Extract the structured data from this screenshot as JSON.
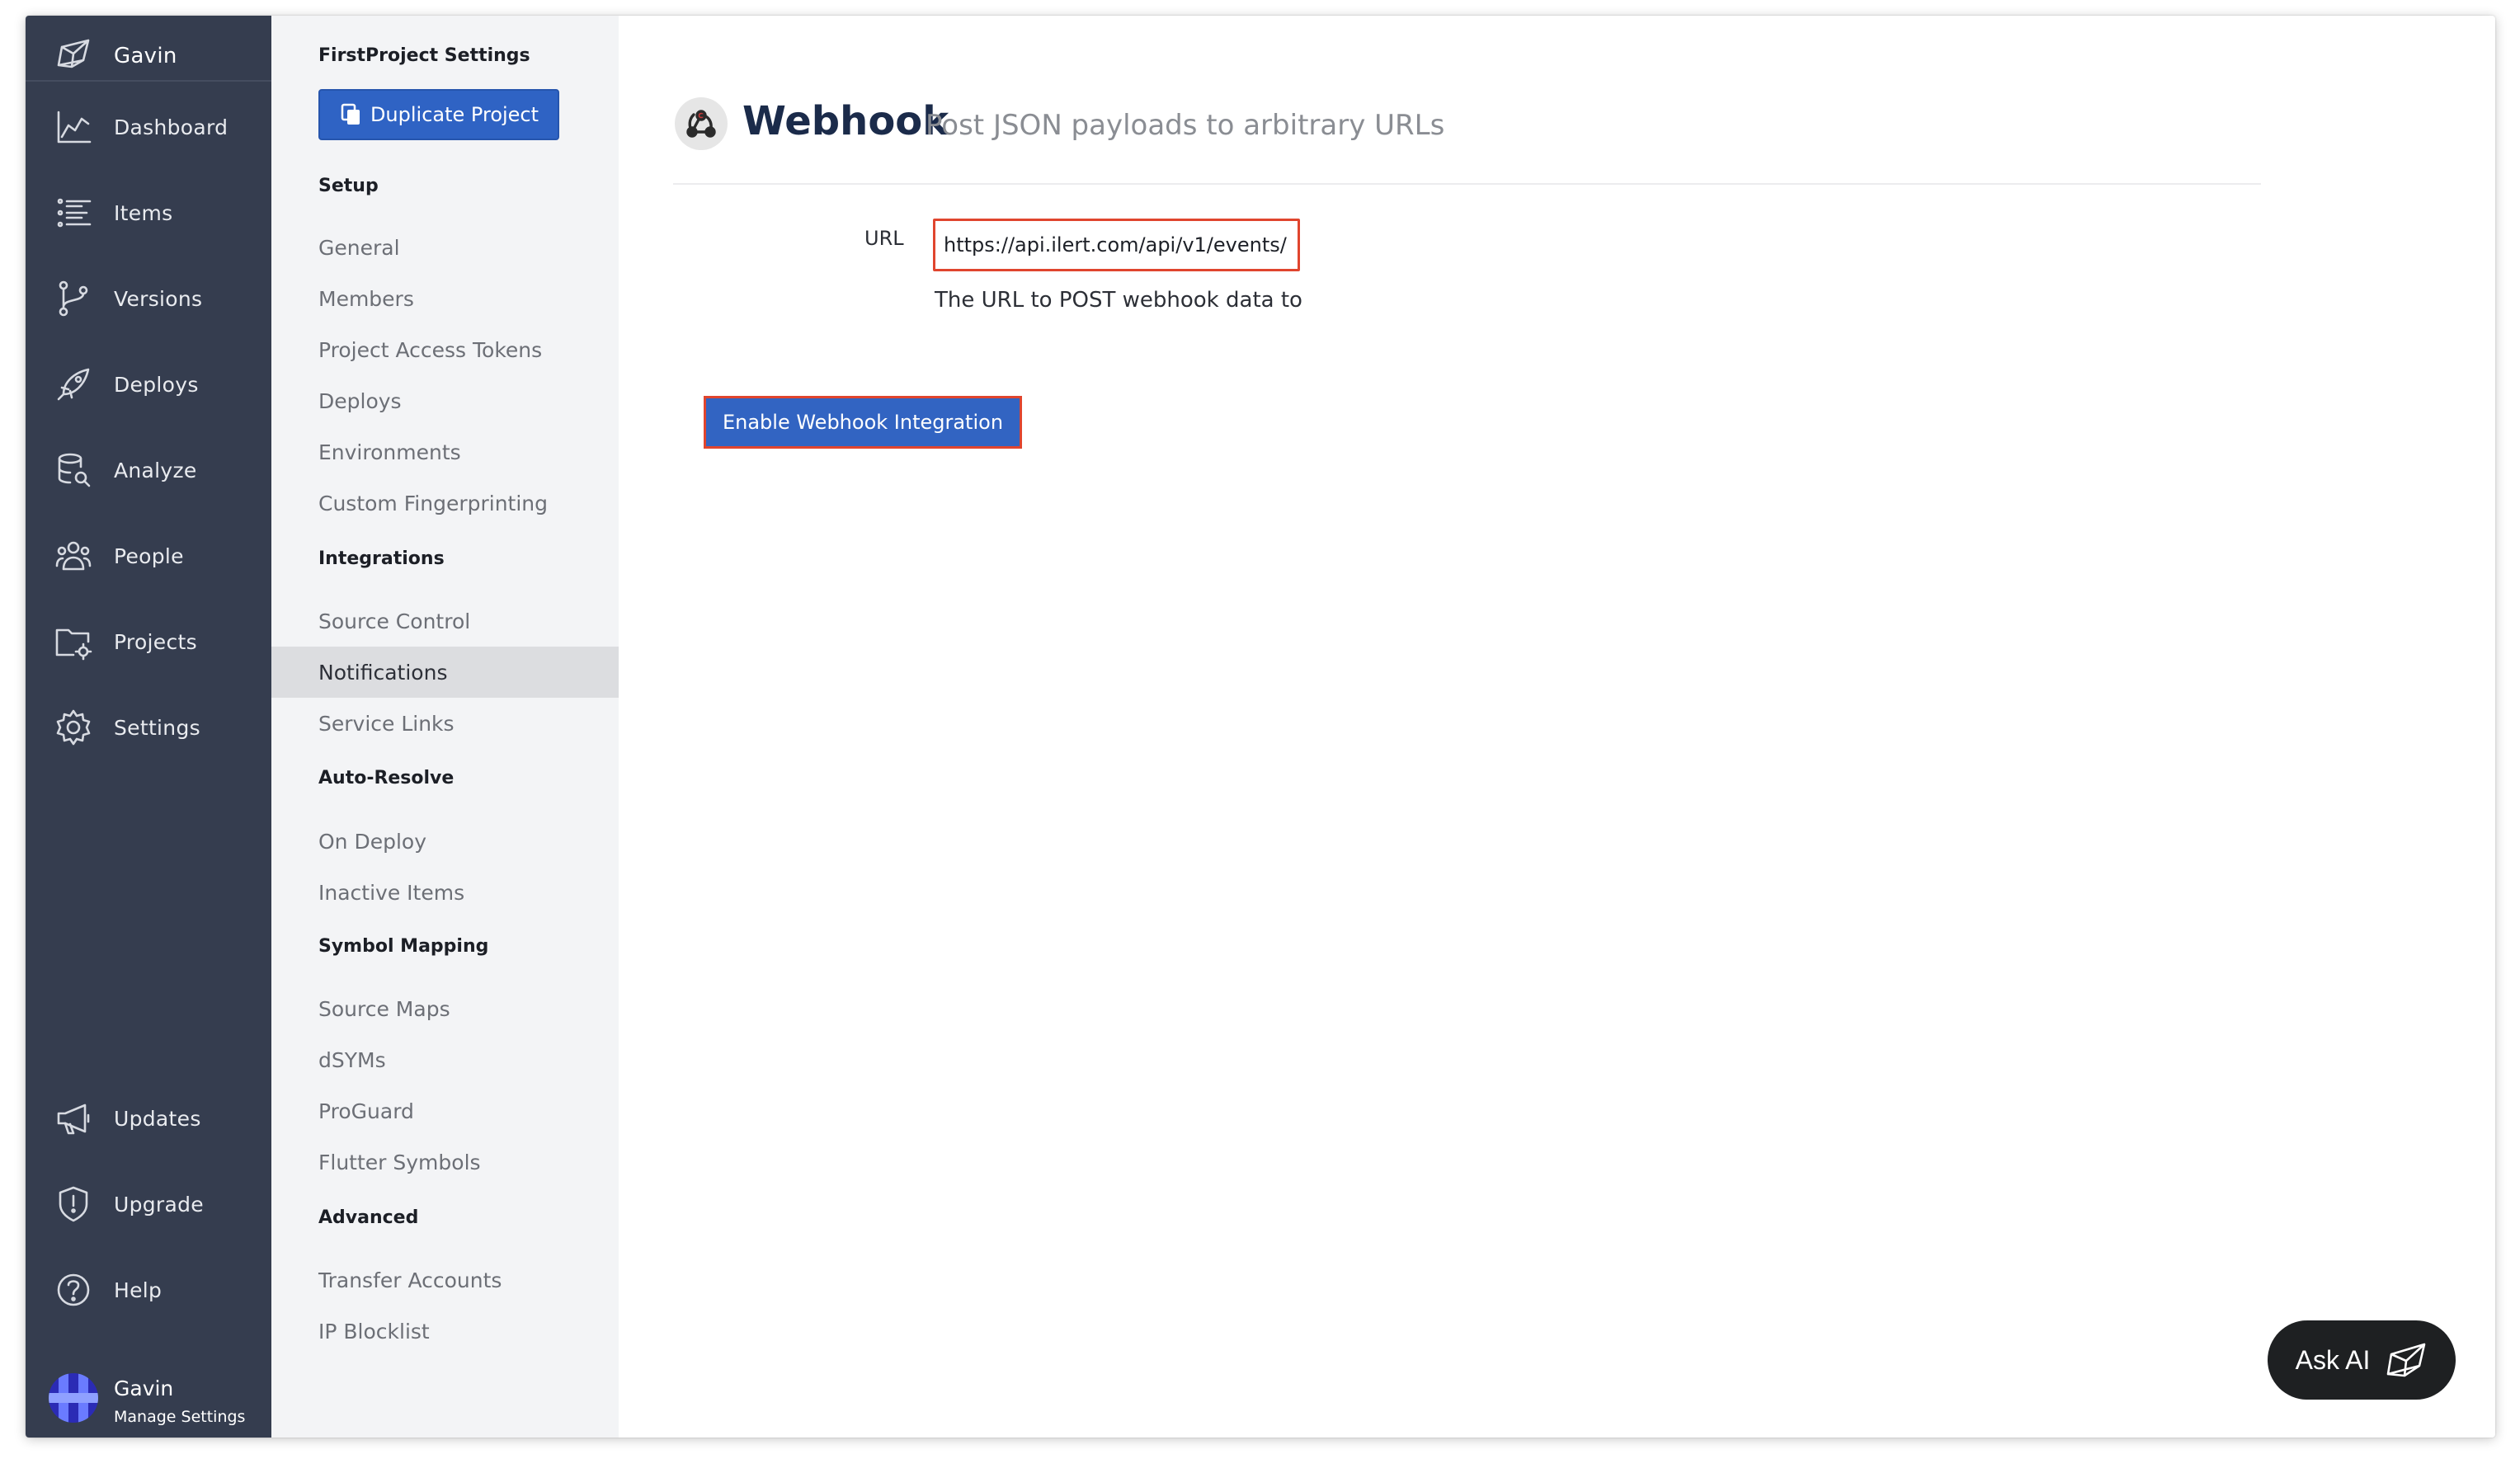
{
  "nav": {
    "brand_user": "Gavin",
    "items": [
      {
        "label": "Dashboard",
        "icon": "chart-line-icon"
      },
      {
        "label": "Items",
        "icon": "list-icon"
      },
      {
        "label": "Versions",
        "icon": "branch-icon"
      },
      {
        "label": "Deploys",
        "icon": "rocket-icon"
      },
      {
        "label": "Analyze",
        "icon": "database-search-icon"
      },
      {
        "label": "People",
        "icon": "people-icon"
      },
      {
        "label": "Projects",
        "icon": "folder-gear-icon"
      },
      {
        "label": "Settings",
        "icon": "gear-icon"
      }
    ],
    "bottom_items": [
      {
        "label": "Updates",
        "icon": "megaphone-icon"
      },
      {
        "label": "Upgrade",
        "icon": "shield-alert-icon"
      },
      {
        "label": "Help",
        "icon": "help-icon"
      }
    ],
    "user": {
      "name": "Gavin",
      "sub": "Manage Settings"
    }
  },
  "settings": {
    "title": "FirstProject Settings",
    "duplicate_label": "Duplicate Project",
    "sections": [
      {
        "heading": "Setup",
        "links": [
          "General",
          "Members",
          "Project Access Tokens",
          "Deploys",
          "Environments",
          "Custom Fingerprinting"
        ]
      },
      {
        "heading": "Integrations",
        "links": [
          "Source Control",
          "Notifications",
          "Service Links"
        ]
      },
      {
        "heading": "Auto-Resolve",
        "links": [
          "On Deploy",
          "Inactive Items"
        ]
      },
      {
        "heading": "Symbol Mapping",
        "links": [
          "Source Maps",
          "dSYMs",
          "ProGuard",
          "Flutter Symbols"
        ]
      },
      {
        "heading": "Advanced",
        "links": [
          "Transfer Accounts",
          "IP Blocklist"
        ]
      }
    ],
    "active_link": "Notifications"
  },
  "webhook": {
    "title": "Webhook",
    "subtitle": "Post JSON payloads to arbitrary URLs",
    "url_label": "URL",
    "url_value": "https://api.ilert.com/api/v1/events/",
    "url_help": "The URL to POST webhook data to",
    "enable_label": "Enable Webhook Integration"
  },
  "ask_ai": {
    "label": "Ask AI"
  },
  "colors": {
    "nav_bg": "#353d4f",
    "settings_bg": "#f3f4f6",
    "primary": "#3264c2",
    "highlight": "#e0452e"
  }
}
